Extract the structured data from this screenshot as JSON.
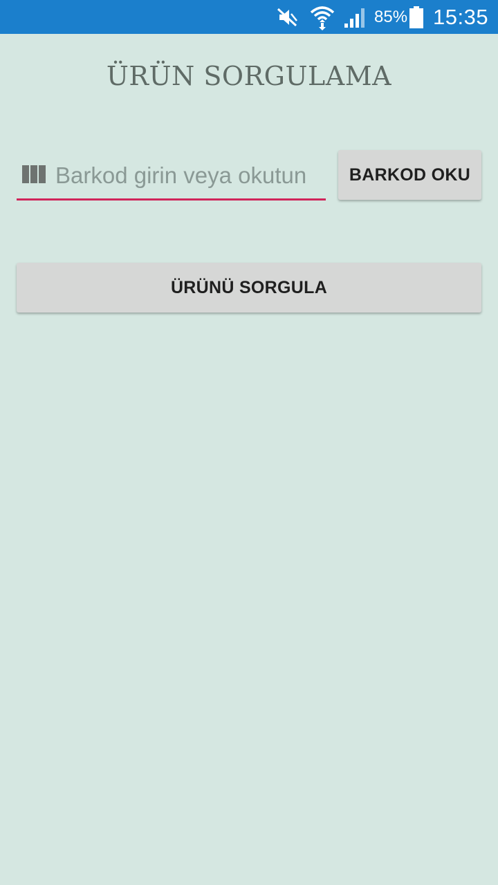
{
  "status_bar": {
    "battery_percent": "85%",
    "time": "15:35",
    "icons": [
      "mute-icon",
      "wifi-icon",
      "signal-icon",
      "battery-icon"
    ],
    "background_color": "#1b7fcc"
  },
  "page": {
    "title": "ÜRÜN SORGULAMA",
    "background_color": "#d5e7e1"
  },
  "barcode_input": {
    "placeholder": "Barkod girin veya okutun",
    "value": "",
    "icon": "barcode-icon",
    "accent_color": "#d0245a"
  },
  "buttons": {
    "scan_label": "BARKOD OKU",
    "query_label": "ÜRÜNÜ SORGULA"
  }
}
